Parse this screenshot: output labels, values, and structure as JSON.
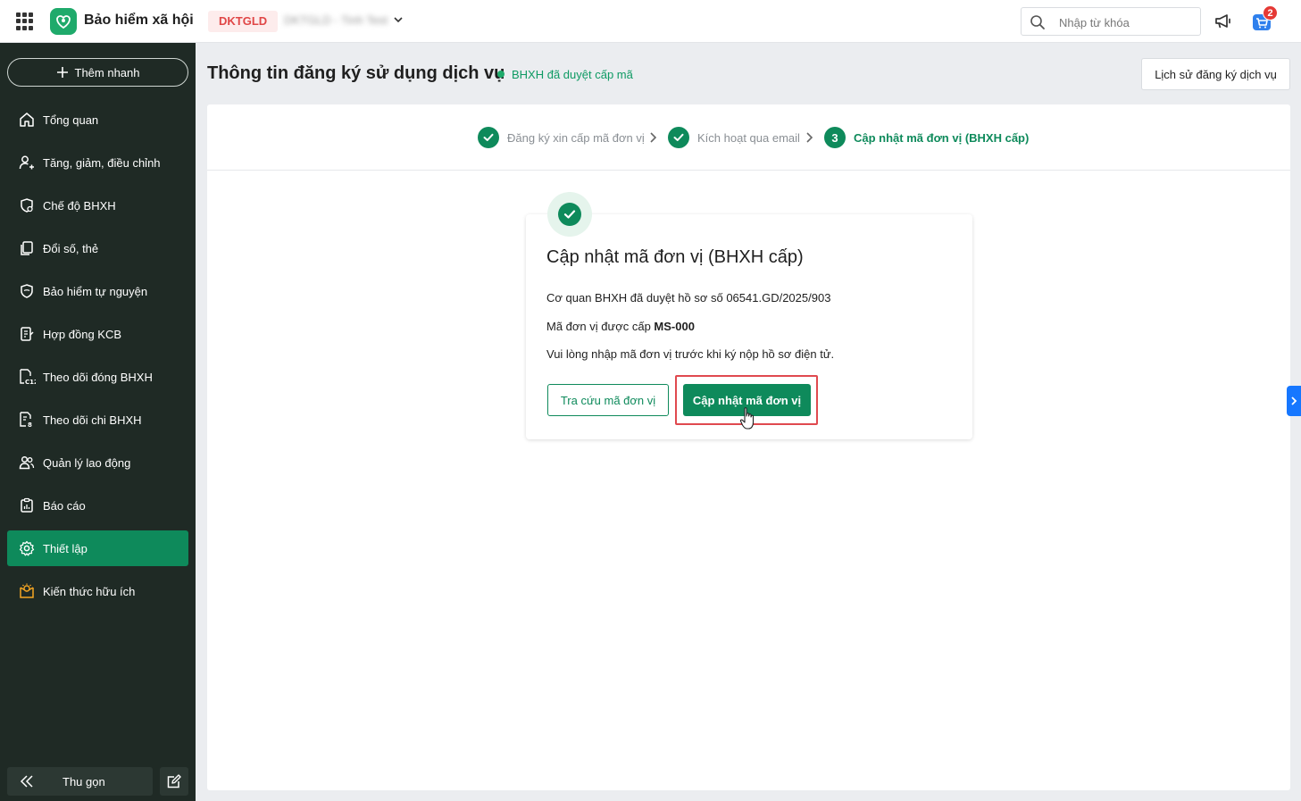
{
  "topbar": {
    "app_title": "Bảo hiểm xã hội",
    "org_code": "DKTGLD",
    "org_name": "DKTGLD - Tinh Test",
    "search_placeholder": "Nhập từ khóa",
    "cart_count": "2"
  },
  "sidebar": {
    "quick_add": "Thêm nhanh",
    "items": [
      {
        "label": "Tổng quan",
        "icon": "home-icon"
      },
      {
        "label": "Tăng, giảm, điều chỉnh",
        "icon": "user-adjust-icon"
      },
      {
        "label": "Chế độ BHXH",
        "icon": "benefit-icon"
      },
      {
        "label": "Đổi số, thẻ",
        "icon": "card-swap-icon"
      },
      {
        "label": "Bảo hiểm tự nguyện",
        "icon": "shield-icon"
      },
      {
        "label": "Hợp đồng KCB",
        "icon": "contract-icon"
      },
      {
        "label": "Theo dõi đóng BHXH",
        "icon": "c12-report-icon"
      },
      {
        "label": "Theo dõi chi BHXH",
        "icon": "payout-report-icon"
      },
      {
        "label": "Quản lý lao động",
        "icon": "people-icon"
      },
      {
        "label": "Báo cáo",
        "icon": "report-icon"
      },
      {
        "label": "Thiết lập",
        "icon": "gear-icon",
        "active": true
      },
      {
        "label": "Kiến thức hữu ích",
        "icon": "knowledge-icon"
      }
    ],
    "collapse_label": "Thu gọn"
  },
  "page": {
    "title": "Thông tin đăng ký sử dụng dịch vụ",
    "status": "BHXH đã duyệt cấp mã",
    "history_button": "Lịch sử đăng ký dịch vụ"
  },
  "steps": [
    {
      "number": "1",
      "label": "Đăng ký xin cấp mã đơn vị",
      "state": "done"
    },
    {
      "number": "2",
      "label": "Kích hoạt qua email",
      "state": "done"
    },
    {
      "number": "3",
      "label": "Cập nhật mã đơn vị (BHXH cấp)",
      "state": "current"
    }
  ],
  "card": {
    "title": "Cập nhật mã đơn vị (BHXH cấp)",
    "line1": "Cơ quan BHXH đã duyệt hồ sơ số 06541.GD/2025/903",
    "line2_prefix": "Mã đơn vị được cấp",
    "line2_code": "MS-000",
    "line3": "Vui lòng nhập mã đơn vị trước khi ký nộp hồ sơ điện tử.",
    "lookup_button": "Tra cứu mã đơn vị",
    "update_button": "Cập nhật mã đơn vị"
  },
  "colors": {
    "brand_green": "#0e8a5b",
    "sidebar_bg": "#1f2a25",
    "highlight_red": "#e0494f",
    "org_code_red": "#e04646"
  }
}
